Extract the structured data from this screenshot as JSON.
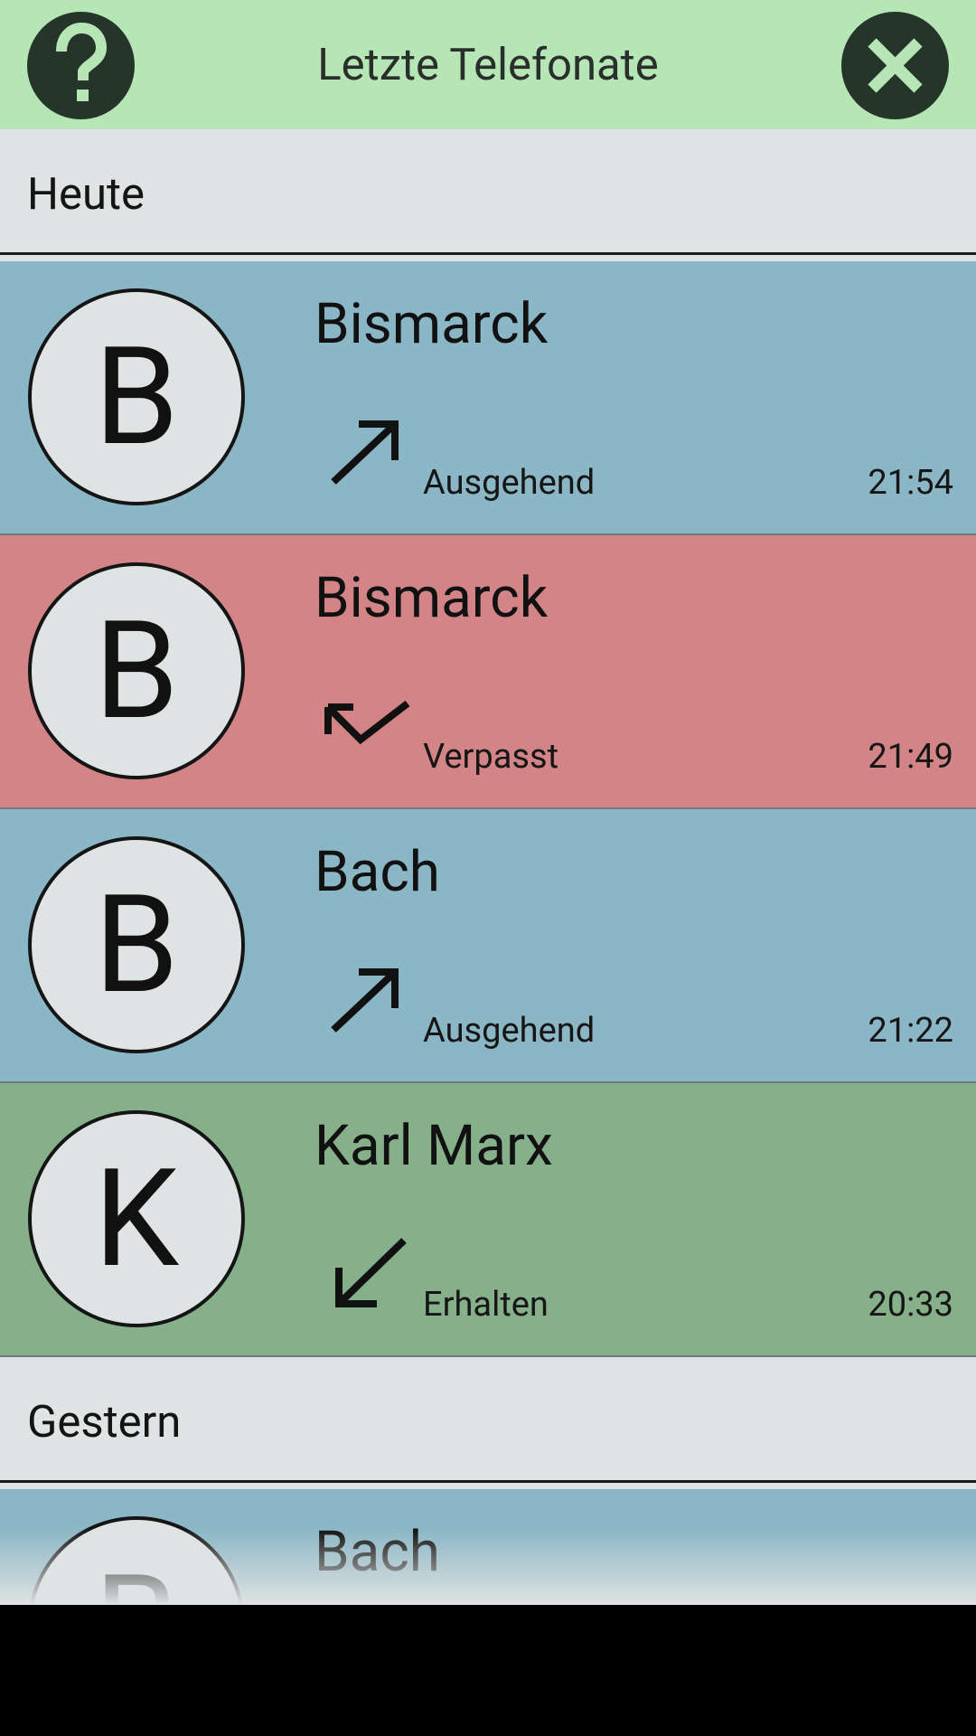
{
  "colors": {
    "header_bg": "#b6e5b6",
    "button_bg": "#26352a",
    "outgoing": "#8bb6c5",
    "missed": "#d38486",
    "received": "#86b08a",
    "section_bg": "#dfe3e3"
  },
  "header": {
    "help_icon": "question-mark-icon",
    "title": "Letzte Telefonate",
    "close_icon": "close-x-icon"
  },
  "sections": [
    {
      "label": "Heute",
      "calls": [
        {
          "initial": "B",
          "name": "Bismarck",
          "direction": "outgoing",
          "direction_icon": "arrow-up-right-icon",
          "status": "Ausgehend",
          "time": "21:54"
        },
        {
          "initial": "B",
          "name": "Bismarck",
          "direction": "missed",
          "direction_icon": "missed-call-arrow-icon",
          "status": "Verpasst",
          "time": "21:49"
        },
        {
          "initial": "B",
          "name": "Bach",
          "direction": "outgoing",
          "direction_icon": "arrow-up-right-icon",
          "status": "Ausgehend",
          "time": "21:22"
        },
        {
          "initial": "K",
          "name": "Karl Marx",
          "direction": "received",
          "direction_icon": "arrow-down-left-icon",
          "status": "Erhalten",
          "time": "20:33"
        }
      ]
    },
    {
      "label": "Gestern",
      "calls": [
        {
          "initial": "B",
          "name": "Bach",
          "direction": "outgoing",
          "direction_icon": "arrow-up-right-icon"
        }
      ]
    }
  ]
}
